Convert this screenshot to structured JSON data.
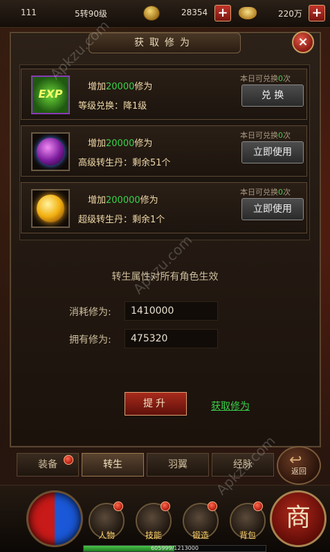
{
  "topbar": {
    "level": "111",
    "reincarnation": "5转90级",
    "gold": "28354",
    "ingot": "220万"
  },
  "panel": {
    "title": "获取修为",
    "close": "×"
  },
  "rows": [
    {
      "icon": "exp-icon",
      "icon_text": "EXP",
      "gain_prefix": "增加",
      "gain_value": "20000",
      "gain_suffix": "修为",
      "desc": "等级兑换：降1级",
      "quota_prefix": "本日可兑换",
      "quota_value": "0",
      "quota_suffix": "次",
      "button": "兑 换"
    },
    {
      "icon": "purple-orb-icon",
      "gain_prefix": "增加",
      "gain_value": "20000",
      "gain_suffix": "修为",
      "desc": "高级转生丹：剩余51个",
      "quota_prefix": "本日可兑换",
      "quota_value": "0",
      "quota_suffix": "次",
      "button": "立即使用"
    },
    {
      "icon": "gold-orb-icon",
      "gain_prefix": "增加",
      "gain_value": "200000",
      "gain_suffix": "修为",
      "desc": "超级转生丹：剩余1个",
      "quota_prefix": "本日可兑换",
      "quota_value": "0",
      "quota_suffix": "次",
      "button": "立即使用"
    }
  ],
  "info": {
    "description": "转生属性对所有角色生效",
    "consume_label": "消耗修为:",
    "consume_value": "1410000",
    "own_label": "拥有修为:",
    "own_value": "475320",
    "upgrade_button": "提升",
    "get_link": "获取修为"
  },
  "tabs": [
    {
      "label": "装备",
      "badge": true
    },
    {
      "label": "转生",
      "active": true
    },
    {
      "label": "羽翼"
    },
    {
      "label": "经脉"
    }
  ],
  "back_button": "返回",
  "hud": {
    "menu": [
      "人物",
      "技能",
      "锻造",
      "背包"
    ],
    "shop": "商",
    "xp_text": "605999/1213000",
    "xp_fraction": 0.4996
  },
  "watermark": "Apkzu.com",
  "colors": {
    "highlight_green": "#3ad14a",
    "accent_red": "#a82a1c"
  }
}
